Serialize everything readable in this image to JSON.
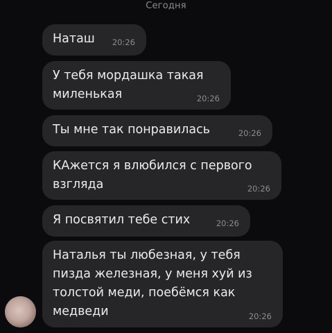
{
  "chat": {
    "date_separator": "Сегодня",
    "messages": [
      {
        "text": "Наташ",
        "time": "20:26"
      },
      {
        "text": "У тебя мордашка такая\nмиленькая",
        "time": "20:26"
      },
      {
        "text": "Ты мне так понравилась",
        "time": "20:26"
      },
      {
        "text": "КАжется я влюбился с первого\nвзгляда",
        "time": "20:26"
      },
      {
        "text": "Я посвятил тебе стих",
        "time": "20:26"
      },
      {
        "text": "Наталья ты любезная, у тебя\nпизда железная, у меня хуй из\nтолстой меди, поебёмся как\nмедведи",
        "time": "20:26"
      }
    ]
  },
  "colors": {
    "background": "#0b0b0d",
    "bubble": "#262628",
    "text": "#ececec",
    "meta_text": "#8c8c90"
  }
}
